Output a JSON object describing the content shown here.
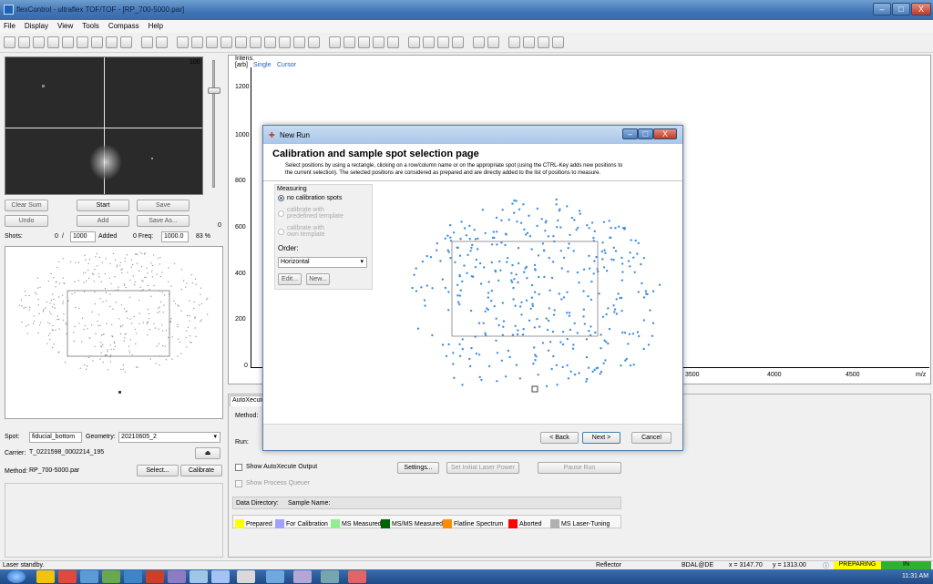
{
  "window": {
    "title": "flexControl - ultraflex TOF/TOF - [RP_700-5000.par]",
    "min": "–",
    "max": "□",
    "close": "X"
  },
  "menu": [
    "File",
    "Display",
    "View",
    "Tools",
    "Compass",
    "Help"
  ],
  "toolbar_icons": [
    "open-icon",
    "save-icon",
    "save2-icon",
    "save3-icon",
    "refresh-icon",
    "camera-icon",
    "tool-icon",
    "print-icon",
    "zoom-icon",
    "zoom2-icon",
    "zoom3-icon",
    "window-icon",
    "window2-icon",
    "spectrum-icon",
    "peak-icon",
    "peak2-icon",
    "peak3-icon",
    "peak4-icon",
    "peak5-icon",
    "peak6-icon",
    "peak7-icon",
    "layout-icon",
    "layout2-icon",
    "layout3-icon",
    "layout4-icon",
    "layout5-icon",
    "info-icon",
    "target-icon",
    "chart-icon",
    "grid-icon",
    "help-icon",
    "whatsthis-icon",
    "range-icon",
    "range2-icon",
    "range3-icon",
    "range4-icon"
  ],
  "video": {
    "slider_value": "100",
    "slider_min": "0"
  },
  "acq": {
    "clear_sum": "Clear Sum",
    "start": "Start",
    "save": "Save",
    "undo": "Undo",
    "add": "Add",
    "save_as": "Save As...",
    "shots_label": "Shots:",
    "shots_value": "0",
    "slash": "/",
    "shots_target": "1000",
    "added_label": "Added",
    "freq_value": "0 Freq:",
    "freq_target": "1000.0",
    "percent": "83 %"
  },
  "spot": {
    "spot_label": "Spot:",
    "spot_value": "fiducial_bottom",
    "geometry_label": "Geometry:",
    "geometry_value": "20210605_2",
    "carrier_label": "Carrier:",
    "carrier_value": "T_0221598_0002214_195",
    "method_label": "Method:",
    "method_value": "RP_700-5000.par",
    "select": "Select...",
    "calibrate": "Calibrate"
  },
  "spectrum": {
    "y_unit_line1": "Intens.",
    "y_unit_line2": "[arb]",
    "tab_single": "Single",
    "tab_cursor": "Cursor",
    "y_ticks": [
      "1200",
      "1000",
      "800",
      "600",
      "400",
      "200",
      "0"
    ],
    "x_ticks": [
      "3500",
      "4000",
      "4500"
    ],
    "x_unit": "m/z"
  },
  "autoxecute": {
    "tab": "AutoXecute",
    "method_label": "Method:",
    "run_label": "Run:",
    "show_output": "Show AutoXecute Output",
    "settings": "Settings...",
    "set_laser": "Set Initial Laser Power",
    "pause": "Pause Run",
    "show_queue": "Show Process Queuer",
    "data_dir": "Data Directory:",
    "sample_name": "Sample Name:",
    "legend": [
      {
        "label": "Prepared",
        "color": "#ffff00"
      },
      {
        "label": "For Calibration",
        "color": "#a0a0ff"
      },
      {
        "label": "MS Measured",
        "color": "#90ee90"
      },
      {
        "label": "MS/MS Measured",
        "color": "#006400"
      },
      {
        "label": "Flatline Spectrum",
        "color": "#ff8c00"
      },
      {
        "label": "Aborted",
        "color": "#ff0000"
      },
      {
        "label": "MS Laser-Tuning",
        "color": "#b0b0b0"
      }
    ]
  },
  "dialog": {
    "title": "New Run",
    "heading": "Calibration and sample spot selection page",
    "desc_line1": "Select positions by using a rectangle, clicking on a row/column name or on the appropriate spot (using the CTRL-Key adds new positions to",
    "desc_line2": "the current selection). The selected positions are considered as prepared and are directly added to the list of positions to measure.",
    "measuring_label": "Measuring",
    "opt_none": "no calibration spots",
    "opt_predef_1": "calibrate with",
    "opt_predef_2": "predefined template",
    "opt_own_1": "calibrate with",
    "opt_own_2": "own template",
    "order_label": "Order:",
    "order_value": "Horizontal",
    "edit": "Edit...",
    "new": "New...",
    "back": "< Back",
    "next": "Next >",
    "cancel": "Cancel"
  },
  "status": {
    "left": "Laser standby.",
    "reflector": "Reflector",
    "user": "BDAL@DE",
    "x": "x = 3147.70",
    "y": "y = 1313.00",
    "preparing": "PREPARING",
    "in": "IN",
    "preparing_color": "#ffff00",
    "in_color": "#2fb12f"
  },
  "taskbar": {
    "time": "11:31 AM"
  }
}
